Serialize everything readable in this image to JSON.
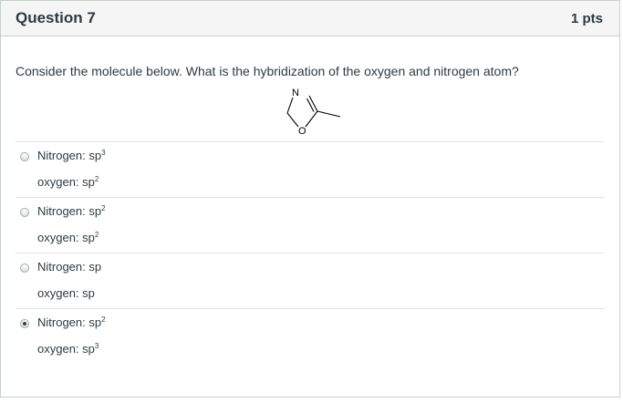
{
  "question": {
    "title": "Question 7",
    "points": "1 pts",
    "text": "Consider the molecule below.  What is the hybridization of the oxygen and nitrogen atom?",
    "molecule": {
      "atom_n": "N",
      "atom_o": "O"
    }
  },
  "answers": [
    {
      "n_label": "Nitrogen: sp",
      "n_sup": "3",
      "o_label": "oxygen: sp",
      "o_sup": "2",
      "selected": false
    },
    {
      "n_label": "Nitrogen: sp",
      "n_sup": "2",
      "o_label": "oxygen: sp",
      "o_sup": "2",
      "selected": false
    },
    {
      "n_label": "Nitrogen: sp",
      "n_sup": "",
      "o_label": "oxygen: sp",
      "o_sup": "",
      "selected": false
    },
    {
      "n_label": "Nitrogen: sp",
      "n_sup": "2",
      "o_label": "oxygen: sp",
      "o_sup": "3",
      "selected": true
    }
  ]
}
